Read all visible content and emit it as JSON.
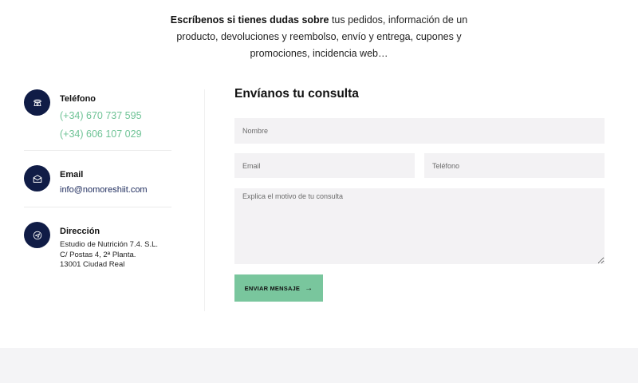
{
  "intro": {
    "bold": "Escríbenos si tienes dudas sobre",
    "line1_rest": " tus pedidos, información de un",
    "line2": "producto, devoluciones y reembolso, envío y entrega, cupones y",
    "line3": "promociones, incidencia web…"
  },
  "contact": {
    "phone": {
      "title": "Teléfono",
      "numbers": [
        "(+34) 670 737 595",
        "(+34) 606 107 029"
      ]
    },
    "email": {
      "title": "Email",
      "address": "info@nomoreshiit.com"
    },
    "address": {
      "title": "Dirección",
      "lines": [
        "Estudio de Nutrición 7.4. S.L.",
        "C/ Postas 4, 2ª Planta.",
        "13001 Ciudad Real"
      ]
    }
  },
  "form": {
    "title": "Envíanos tu consulta",
    "name_placeholder": "Nombre",
    "email_placeholder": "Email",
    "phone_placeholder": "Teléfono",
    "message_placeholder": "Explica el motivo de tu consulta",
    "submit_label": "ENVIAR MENSAJE",
    "submit_icon": "→"
  },
  "colors": {
    "accent_green": "#79c69d",
    "phone_green": "#6fc396",
    "icon_navy": "#101c46",
    "field_bg": "#f3f2f4"
  }
}
